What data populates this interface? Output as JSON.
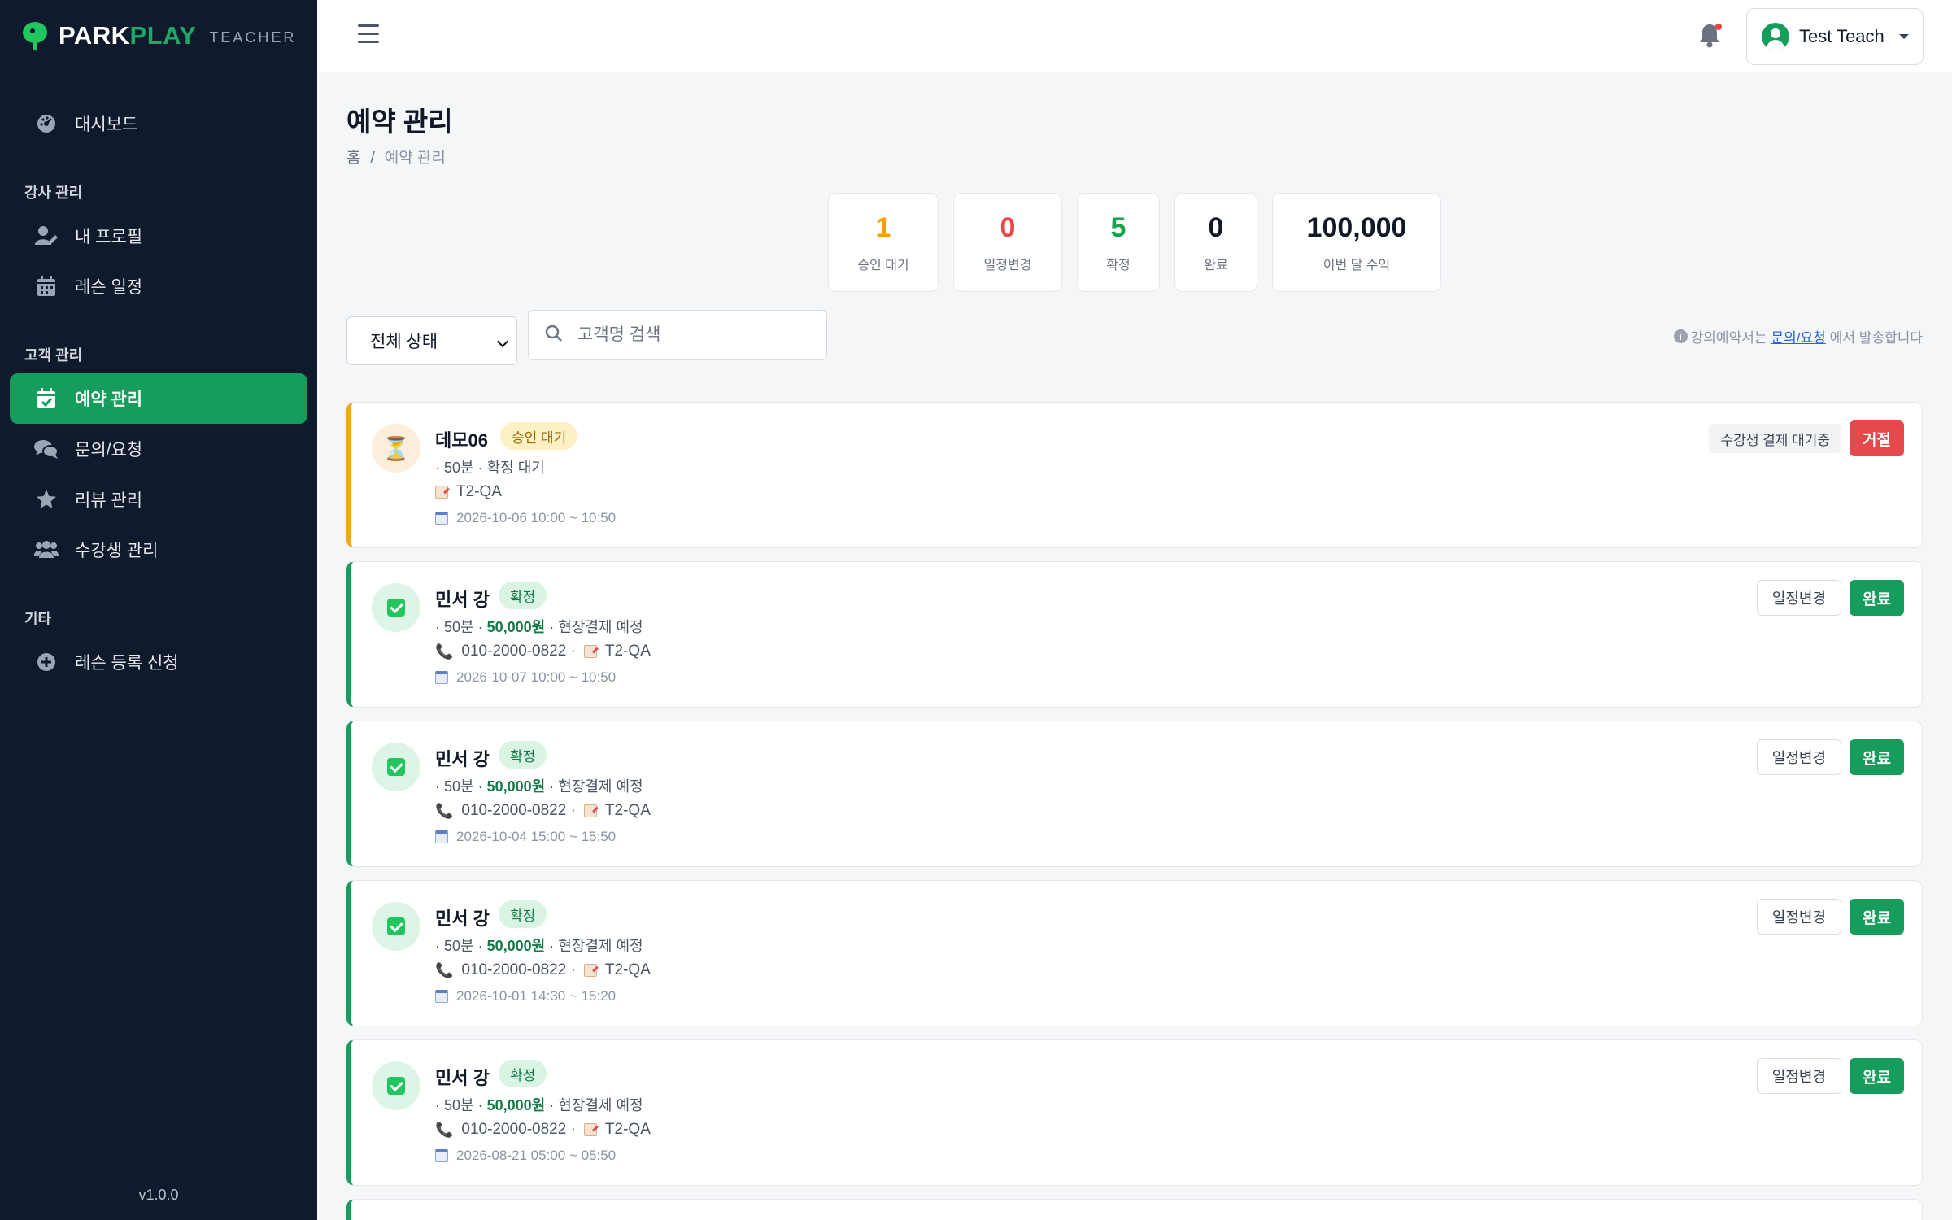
{
  "brand": {
    "part1": "PARK",
    "part2": "PLAY",
    "sub": "TEACHER"
  },
  "sidebar": {
    "dashboard": "대시보드",
    "section_instructor": "강사 관리",
    "my_profile": "내 프로필",
    "lesson_schedule": "레슨 일정",
    "section_customer": "고객 관리",
    "reservations": "예약 관리",
    "inquiries": "문의/요청",
    "reviews": "리뷰 관리",
    "students": "수강생 관리",
    "section_etc": "기타",
    "lesson_register": "레슨 등록 신청",
    "version": "v1.0.0"
  },
  "topbar": {
    "user_name": "Test Teach"
  },
  "page": {
    "title": "예약 관리",
    "breadcrumb_home": "홈",
    "breadcrumb_sep": "/",
    "breadcrumb_current": "예약 관리"
  },
  "stats": [
    {
      "value": "1",
      "label": "승인 대기",
      "color": "#f59e0b"
    },
    {
      "value": "0",
      "label": "일정변경",
      "color": "#ef4444"
    },
    {
      "value": "5",
      "label": "확정",
      "color": "#16a34a"
    },
    {
      "value": "0",
      "label": "완료",
      "color": "#111827"
    },
    {
      "value": "100,000",
      "label": "이번 달 수익",
      "color": "#111827"
    }
  ],
  "filters": {
    "status_selected": "전체 상태",
    "search_placeholder": "고객명 검색",
    "notice_pre": "강의예약서는",
    "notice_link": "문의/요청",
    "notice_post": "에서 발송합니다"
  },
  "reservations": [
    {
      "name": "데모06",
      "badge": "승인 대기",
      "meta": "· 50분 · 확정 대기",
      "location": "T2-QA",
      "datetime": "2026-10-06 10:00 ~ 10:50",
      "tag": "수강생 결제 대기중",
      "action": "거절"
    },
    {
      "name": "민서 강",
      "badge": "확정",
      "meta_pre": "· 50분 ·",
      "price": "50,000원",
      "meta_post": "· 현장결제 예정",
      "phone": "010-2000-0822 ·",
      "location": "T2-QA",
      "datetime": "2026-10-07 10:00 ~ 10:50",
      "secondary": "일정변경",
      "action": "완료"
    },
    {
      "name": "민서 강",
      "badge": "확정",
      "meta_pre": "· 50분 ·",
      "price": "50,000원",
      "meta_post": "· 현장결제 예정",
      "phone": "010-2000-0822 ·",
      "location": "T2-QA",
      "datetime": "2026-10-04 15:00 ~ 15:50",
      "secondary": "일정변경",
      "action": "완료"
    },
    {
      "name": "민서 강",
      "badge": "확정",
      "meta_pre": "· 50분 ·",
      "price": "50,000원",
      "meta_post": "· 현장결제 예정",
      "phone": "010-2000-0822 ·",
      "location": "T2-QA",
      "datetime": "2026-10-01 14:30 ~ 15:20",
      "secondary": "일정변경",
      "action": "완료"
    },
    {
      "name": "민서 강",
      "badge": "확정",
      "meta_pre": "· 50분 ·",
      "price": "50,000원",
      "meta_post": "· 현장결제 예정",
      "phone": "010-2000-0822 ·",
      "location": "T2-QA",
      "datetime": "2026-08-21 05:00 ~ 05:50",
      "secondary": "일정변경",
      "action": "완료"
    }
  ]
}
